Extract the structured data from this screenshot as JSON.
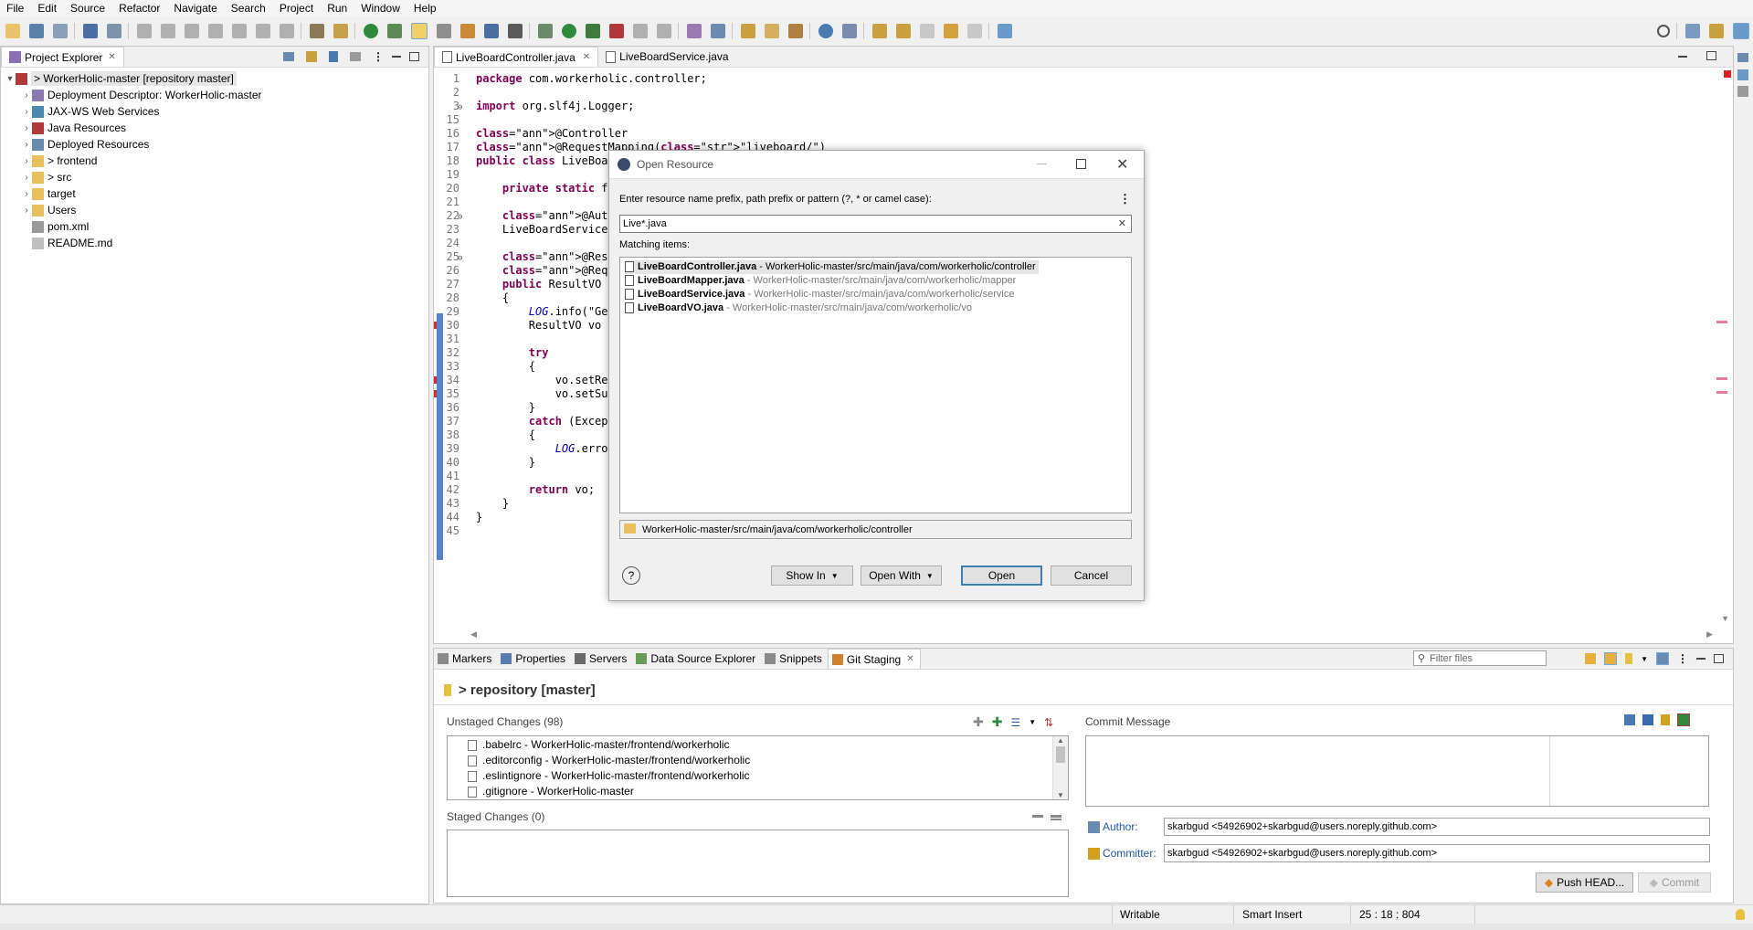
{
  "menu": [
    "File",
    "Edit",
    "Source",
    "Refactor",
    "Navigate",
    "Search",
    "Project",
    "Run",
    "Window",
    "Help"
  ],
  "project_explorer": {
    "tab_label": "Project Explorer",
    "root": "> WorkerHolic-master [repository master]",
    "items": [
      {
        "label": "Deployment Descriptor: WorkerHolic-master",
        "icon": "descriptor-icon",
        "expandable": true
      },
      {
        "label": "JAX-WS Web Services",
        "icon": "webservice-icon",
        "expandable": true
      },
      {
        "label": "Java Resources",
        "icon": "java-resources-icon",
        "expandable": true
      },
      {
        "label": "Deployed Resources",
        "icon": "deployed-icon",
        "expandable": true
      },
      {
        "label": "> frontend",
        "icon": "folder-icon",
        "expandable": true
      },
      {
        "label": "> src",
        "icon": "folder-icon",
        "expandable": true
      },
      {
        "label": "target",
        "icon": "folder-icon",
        "expandable": true
      },
      {
        "label": "Users",
        "icon": "folder-icon",
        "expandable": true
      },
      {
        "label": "pom.xml",
        "icon": "xml-file-icon",
        "expandable": false
      },
      {
        "label": "README.md",
        "icon": "file-icon",
        "expandable": false
      }
    ]
  },
  "editor": {
    "tabs": [
      {
        "label": "LiveBoardController.java",
        "active": true
      },
      {
        "label": "LiveBoardService.java",
        "active": false
      }
    ],
    "lines": [
      {
        "n": "1",
        "t": "package com.workerholic.controller;"
      },
      {
        "n": "2",
        "t": ""
      },
      {
        "n": "3",
        "t": "import org.slf4j.Logger;"
      },
      {
        "n": "15",
        "t": ""
      },
      {
        "n": "16",
        "t": "@Controller"
      },
      {
        "n": "17",
        "t": "@RequestMapping(\"liveboard/\")"
      },
      {
        "n": "18",
        "t": "public class LiveBoard"
      },
      {
        "n": "19",
        "t": ""
      },
      {
        "n": "20",
        "t": "    private static fin"
      },
      {
        "n": "21",
        "t": ""
      },
      {
        "n": "22",
        "t": "    @Autowired"
      },
      {
        "n": "23",
        "t": "    LiveBoardService s"
      },
      {
        "n": "24",
        "t": ""
      },
      {
        "n": "25",
        "t": "    @ResponseBody"
      },
      {
        "n": "26",
        "t": "    @RequestMapping(va"
      },
      {
        "n": "27",
        "t": "    public ResultVO ge"
      },
      {
        "n": "28",
        "t": "    {"
      },
      {
        "n": "29",
        "t": "        LOG.info(\"GetL"
      },
      {
        "n": "30",
        "t": "        ResultVO vo = "
      },
      {
        "n": "31",
        "t": ""
      },
      {
        "n": "32",
        "t": "        try"
      },
      {
        "n": "33",
        "t": "        {"
      },
      {
        "n": "34",
        "t": "            vo.setResu"
      },
      {
        "n": "35",
        "t": "            vo.setSucc"
      },
      {
        "n": "36",
        "t": "        }"
      },
      {
        "n": "37",
        "t": "        catch (Excepti"
      },
      {
        "n": "38",
        "t": "        {"
      },
      {
        "n": "39",
        "t": "            LOG.error("
      },
      {
        "n": "40",
        "t": "        }"
      },
      {
        "n": "41",
        "t": ""
      },
      {
        "n": "42",
        "t": "        return vo;"
      },
      {
        "n": "43",
        "t": "    }"
      },
      {
        "n": "44",
        "t": "}"
      },
      {
        "n": "45",
        "t": ""
      }
    ]
  },
  "dialog": {
    "title": "Open Resource",
    "prompt": "Enter resource name prefix, path prefix or pattern (?, * or camel case):",
    "search_value": "Live*.java",
    "matching_label": "Matching items:",
    "items": [
      {
        "bold": "LiveBoard",
        "rest": "Controller.java",
        "path": " - WorkerHolic-master/src/main/java/com/workerholic/controller",
        "selected": true
      },
      {
        "bold": "LiveBoard",
        "rest": "Mapper.java",
        "path": " - WorkerHolic-master/src/main/java/com/workerholic/mapper",
        "selected": false
      },
      {
        "bold": "LiveBoard",
        "rest": "Service.java",
        "path": " - WorkerHolic-master/src/main/java/com/workerholic/service",
        "selected": false
      },
      {
        "bold": "LiveBoard",
        "rest": "VO.java",
        "path": " - WorkerHolic-master/src/main/java/com/workerholic/vo",
        "selected": false
      }
    ],
    "selected_path": "WorkerHolic-master/src/main/java/com/workerholic/controller",
    "show_in": "Show In",
    "open_with": "Open With",
    "open": "Open",
    "cancel": "Cancel"
  },
  "bottom_tabs": [
    {
      "label": "Markers",
      "icon": "markers-icon"
    },
    {
      "label": "Properties",
      "icon": "properties-icon"
    },
    {
      "label": "Servers",
      "icon": "servers-icon"
    },
    {
      "label": "Data Source Explorer",
      "icon": "datasource-icon"
    },
    {
      "label": "Snippets",
      "icon": "snippets-icon"
    },
    {
      "label": "Git Staging",
      "icon": "git-staging-icon",
      "active": true
    }
  ],
  "git": {
    "filter_placeholder": "Filter files",
    "repo_title": "> repository [master]",
    "unstaged_label": "Unstaged Changes (98)",
    "unstaged": [
      ".babelrc - WorkerHolic-master/frontend/workerholic",
      ".editorconfig - WorkerHolic-master/frontend/workerholic",
      ".eslintignore - WorkerHolic-master/frontend/workerholic",
      ".gitignore - WorkerHolic-master"
    ],
    "staged_label": "Staged Changes (0)",
    "commit_message_label": "Commit Message",
    "author_label": "Author:",
    "author_value": "skarbgud <54926902+skarbgud@users.noreply.github.com>",
    "committer_label": "Committer:",
    "committer_value": "skarbgud <54926902+skarbgud@users.noreply.github.com>",
    "push_label": "Push HEAD...",
    "commit_label": "Commit"
  },
  "status": {
    "writable": "Writable",
    "insert": "Smart Insert",
    "position": "25 : 18 : 804"
  }
}
